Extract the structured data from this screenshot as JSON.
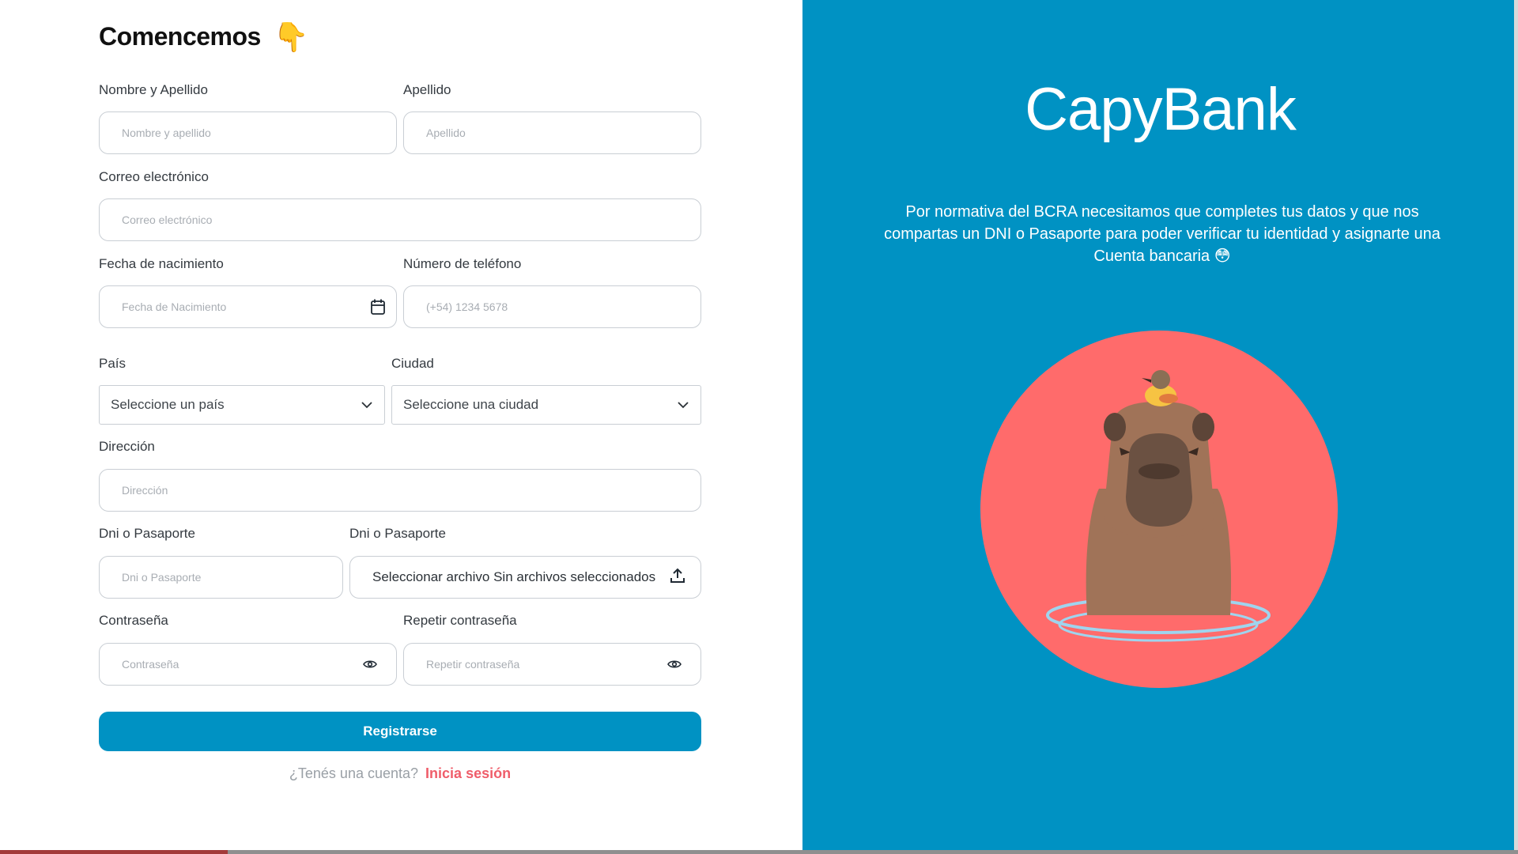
{
  "form": {
    "title": "Comencemos",
    "title_emoji": "👇",
    "fields": {
      "first_name": {
        "label": "Nombre y Apellido",
        "placeholder": "Nombre y apellido"
      },
      "last_name": {
        "label": "Apellido",
        "placeholder": "Apellido"
      },
      "email": {
        "label": "Correo electrónico",
        "placeholder": "Correo electrónico"
      },
      "birthdate": {
        "label": "Fecha de nacimiento",
        "placeholder": "Fecha de Nacimiento"
      },
      "phone": {
        "label": "Número de teléfono",
        "placeholder": "(+54) 1234 5678"
      },
      "country": {
        "label": "País",
        "value": "Seleccione un país"
      },
      "city": {
        "label": "Ciudad",
        "value": "Seleccione una ciudad"
      },
      "address": {
        "label": "Dirección",
        "placeholder": "Dirección"
      },
      "dni": {
        "label": "Dni o Pasaporte",
        "placeholder": "Dni o Pasaporte"
      },
      "dni_file": {
        "label": "Dni o Pasaporte",
        "value": "Seleccionar archivo Sin archivos seleccionados"
      },
      "password": {
        "label": "Contraseña",
        "placeholder": "Contraseña"
      },
      "password_repeat": {
        "label": "Repetir contraseña",
        "placeholder": "Repetir contraseña"
      }
    },
    "submit_label": "Registrarse",
    "login_prompt": "¿Tenés una cuenta?",
    "login_link": "Inicia sesión"
  },
  "hero": {
    "brand": "CapyBank",
    "description": "Por normativa del BCRA necesitamos que completes tus datos y que nos compartas un DNI o Pasaporte para poder verificar tu identidad y asignarte una Cuenta bancaria 😳"
  },
  "colors": {
    "primary": "#0092c3",
    "accent": "#ef5d6a",
    "circle": "#ff6b6b"
  },
  "icons": [
    "calendar-icon",
    "chevron-down-icon",
    "upload-icon",
    "eye-icon",
    "pointing-down-emoji"
  ]
}
